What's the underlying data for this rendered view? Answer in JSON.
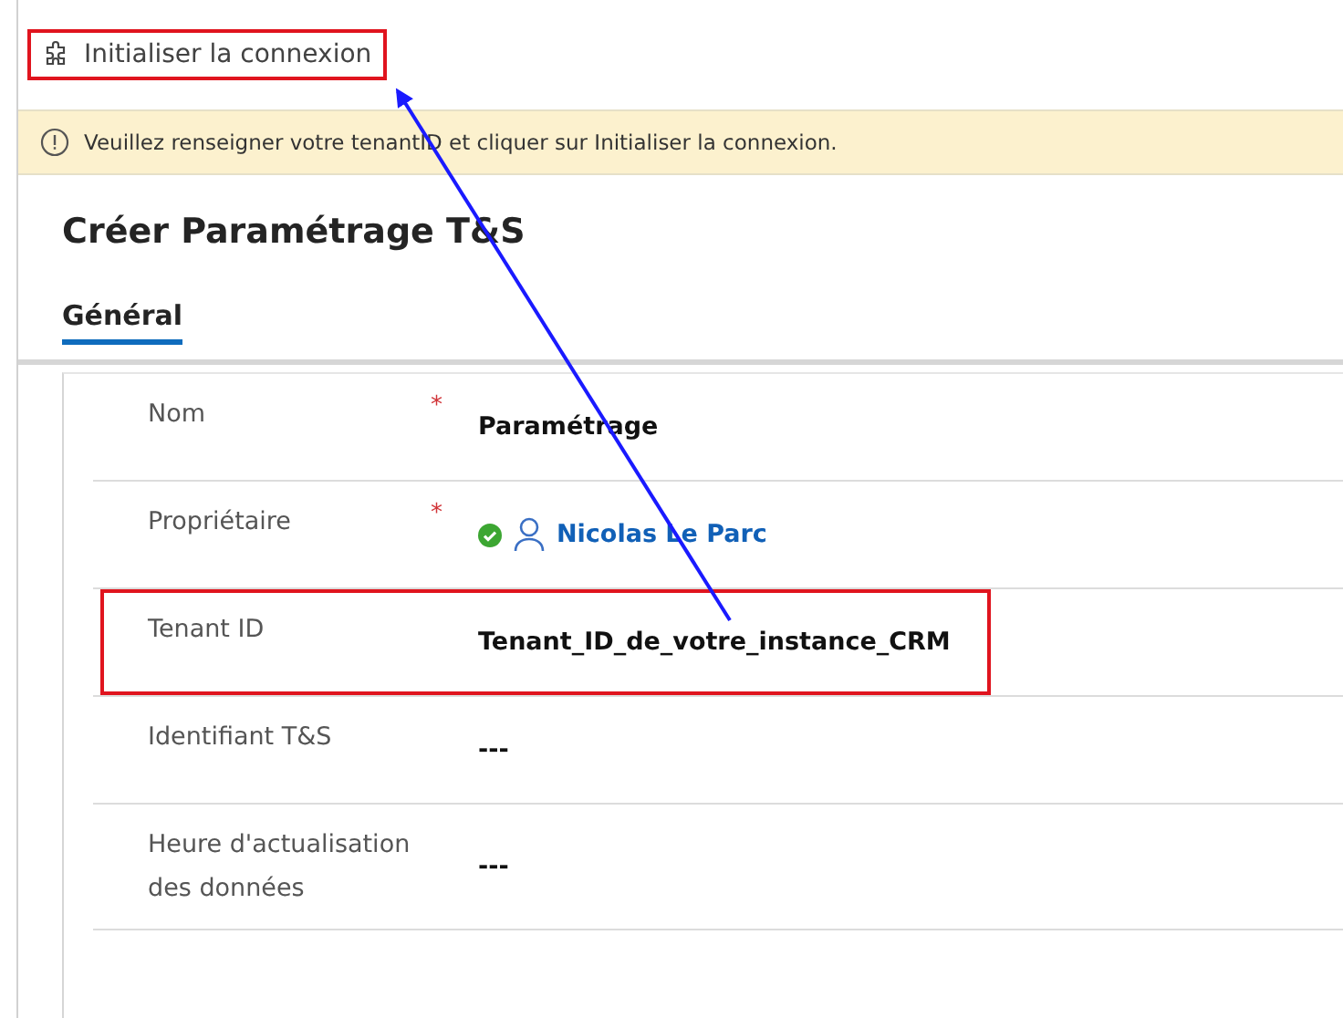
{
  "toolbar": {
    "button": {
      "label": "Initialiser la connexion",
      "highlighted": true
    }
  },
  "banner": {
    "text": "Veuillez renseigner votre tenantID et cliquer sur Initialiser la connexion."
  },
  "form": {
    "title": "Créer Paramétrage T&S",
    "tabs": [
      {
        "label": "Général",
        "selected": true
      }
    ],
    "fields": [
      {
        "label": "Nom",
        "required": true,
        "kind": "text",
        "value": "Paramétrage",
        "highlighted": false
      },
      {
        "label": "Propriétaire",
        "required": true,
        "kind": "lookup",
        "value": "Nicolas Le Parc",
        "highlighted": false
      },
      {
        "label": "Tenant ID",
        "required": false,
        "kind": "text",
        "value": "Tenant_ID_de_votre_instance_CRM",
        "highlighted": true
      },
      {
        "label": "Identifiant T&S",
        "required": false,
        "kind": "text",
        "value": "---",
        "highlighted": false
      },
      {
        "label": "Heure d'actualisation des données",
        "required": false,
        "kind": "text",
        "value": "---",
        "highlighted": false
      }
    ]
  },
  "required_mark": "*"
}
